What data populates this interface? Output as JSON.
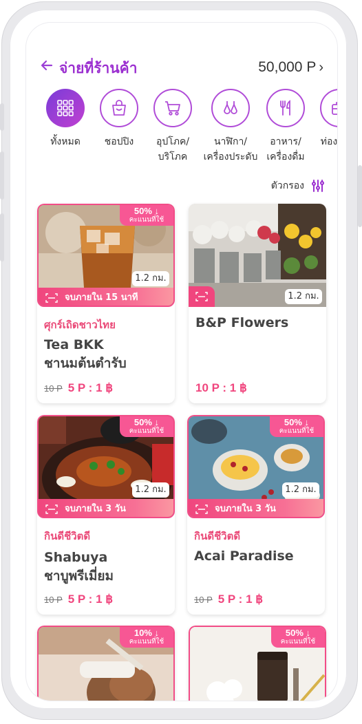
{
  "header": {
    "title": "จ่ายที่ร้านค้า",
    "points": "50,000 P"
  },
  "categories": [
    {
      "label": "ทั้งหมด",
      "icon": "grid-icon",
      "active": true
    },
    {
      "label": "ชอปปิง",
      "icon": "shopping-bag-icon"
    },
    {
      "label": "อุปโภค/\nบริโภค",
      "icon": "cart-icon"
    },
    {
      "label": "นาฬิกา/\nเครื่องประดับ",
      "icon": "earrings-icon"
    },
    {
      "label": "อาหาร/\nเครื่องดื่ม",
      "icon": "utensils-icon"
    },
    {
      "label": "ท่องเที่ยว",
      "icon": "travel-icon"
    }
  ],
  "filter": {
    "label": "ตัวกรอง"
  },
  "colors": {
    "accent": "#9b2fd0",
    "pink": "#f0467e"
  },
  "cards": [
    {
      "badge_pct": "50% ↓",
      "badge_sub": "คะแนนที่ใช้",
      "distance": "1.2 กม.",
      "timer": "จบภายใน 15 นาที",
      "category": "ศุกร์เถิดชาวไทย",
      "name": "Tea BKK\nชานมต้นตำรับ",
      "old_price": "10 P",
      "price": "5 P : 1 ฿"
    },
    {
      "distance": "1.2 กม.",
      "category": "",
      "name": "B&P Flowers",
      "old_price": "",
      "price": "10 P : 1 ฿"
    },
    {
      "badge_pct": "50% ↓",
      "badge_sub": "คะแนนที่ใช้",
      "distance": "1.2 กม.",
      "timer": "จบภายใน 3 วัน",
      "category": "กินดีชีวิตดี",
      "name": "Shabuya\nชาบูพรีเมี่ยม",
      "old_price": "10 P",
      "price": "5 P : 1 ฿"
    },
    {
      "badge_pct": "50% ↓",
      "badge_sub": "คะแนนที่ใช้",
      "distance": "1.2 กม.",
      "timer": "จบภายใน 3 วัน",
      "category": "กินดีชีวิตดี",
      "name": "Acai Paradise",
      "old_price": "10 P",
      "price": "5 P : 1 ฿"
    },
    {
      "badge_pct": "10% ↓",
      "badge_sub": "คะแนนที่ใช้"
    },
    {
      "badge_pct": "50% ↓",
      "badge_sub": "คะแนนที่ใช้"
    }
  ]
}
